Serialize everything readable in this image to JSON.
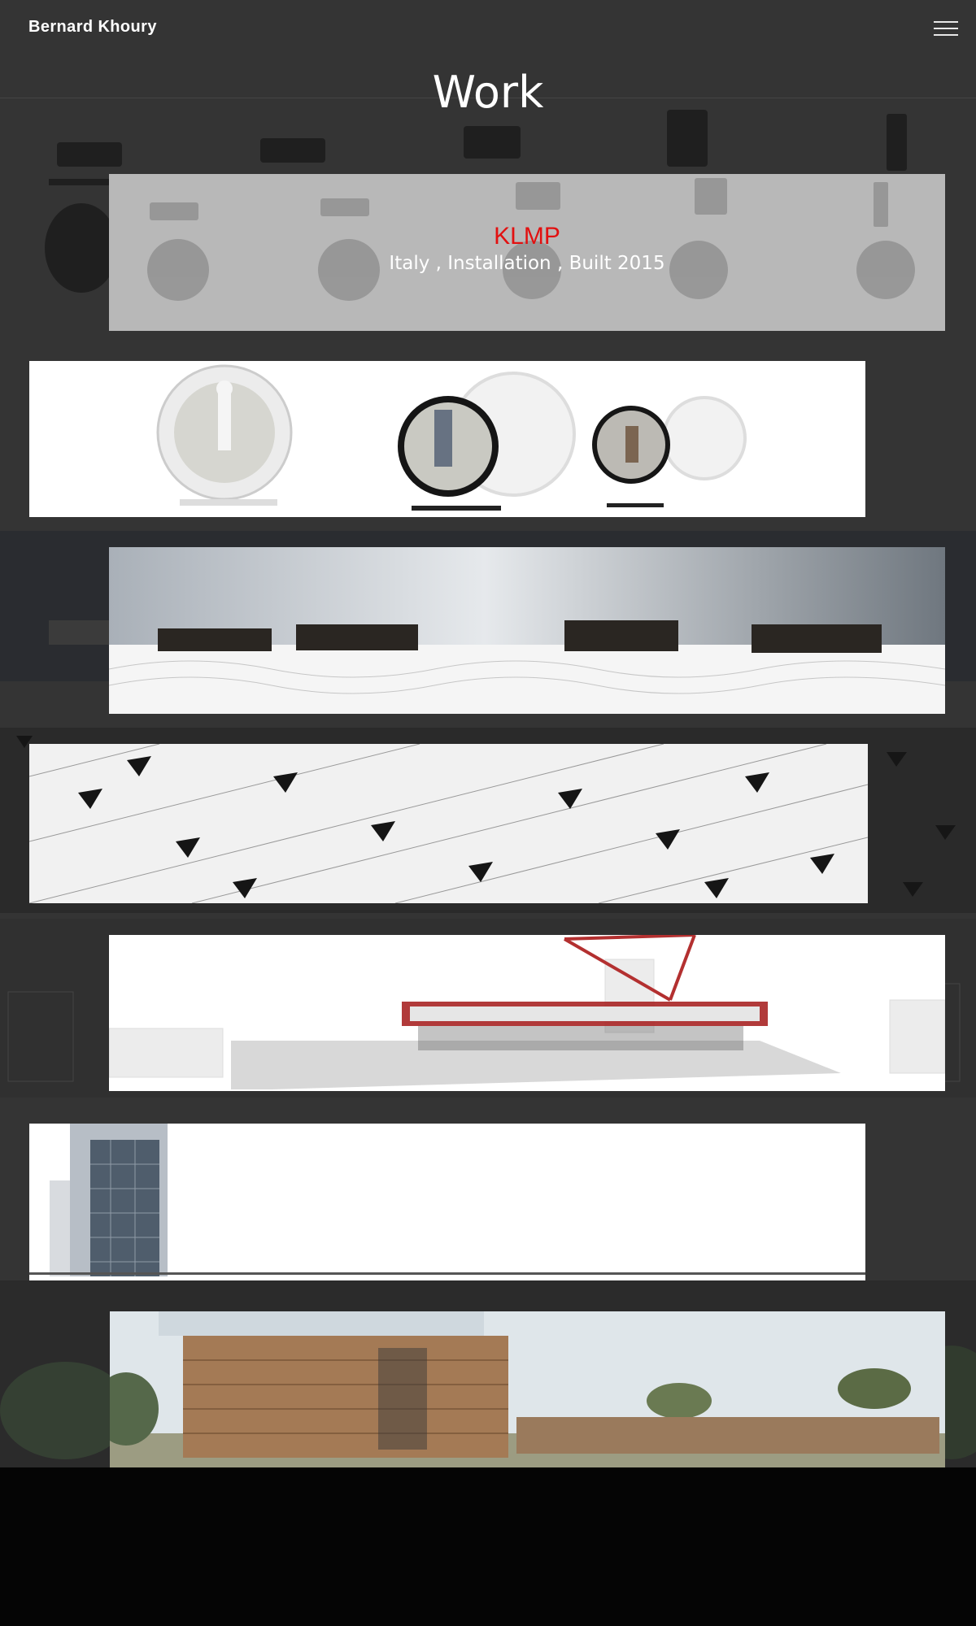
{
  "header": {
    "brand": "Bernard Khoury",
    "menu_icon": "hamburger-menu-icon"
  },
  "page_title": "Work",
  "projects": [
    {
      "title": "KLMP",
      "meta": "Italy , Installation , Built 2015",
      "hovered": true
    },
    {
      "title": ""
    },
    {
      "title": ""
    },
    {
      "title": ""
    },
    {
      "title": ""
    },
    {
      "title": ""
    },
    {
      "title": ""
    }
  ],
  "colors": {
    "background": "#343434",
    "accent_red": "#e21010",
    "footer": "#050505"
  }
}
